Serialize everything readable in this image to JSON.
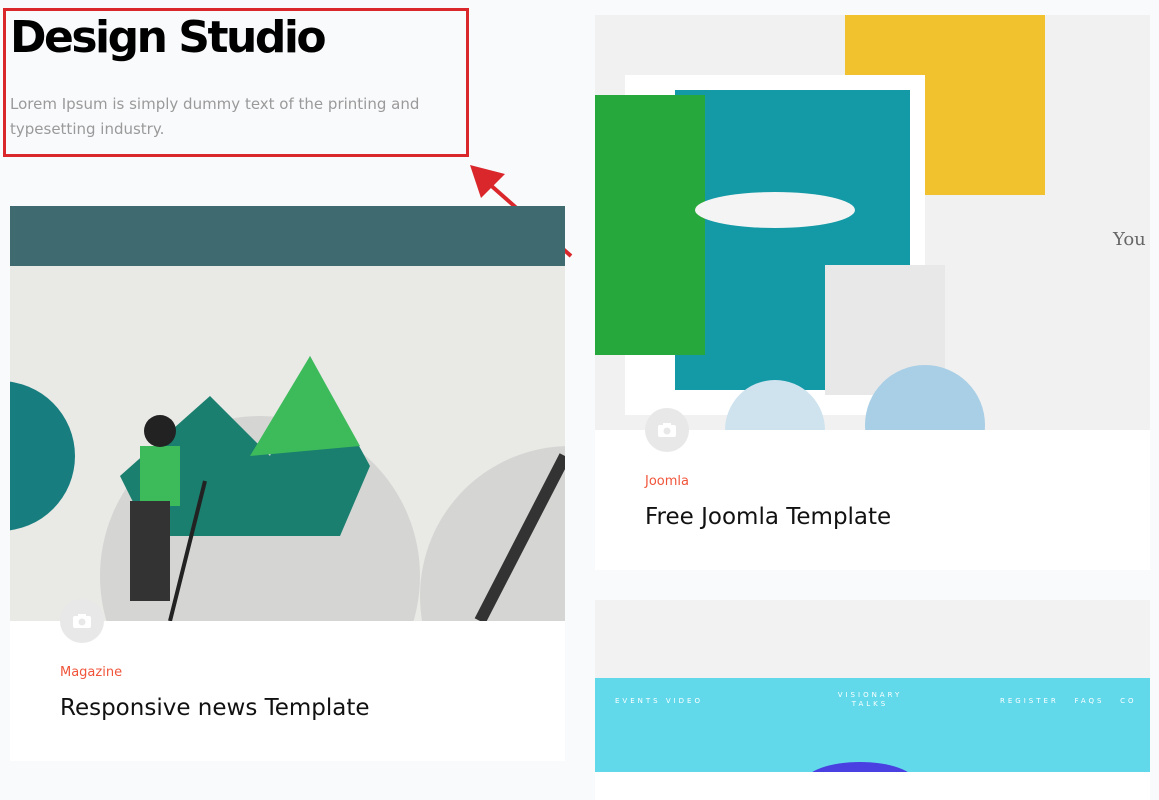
{
  "hero": {
    "title": "Design Studio",
    "subtitle": "Lorem Ipsum is simply dummy text of the printing and typesetting industry."
  },
  "cards": [
    {
      "category": "Magazine",
      "title": "Responsive news Template",
      "icon": "camera-icon"
    },
    {
      "category": "Joomla",
      "title": "Free Joomla Template",
      "icon": "camera-icon"
    },
    {
      "thumb_text": {
        "left": "EVENTS   VIDEO",
        "center": "VISIONARY TALKS",
        "right": "REGISTER   FAQS   CO"
      }
    }
  ],
  "colors": {
    "accent": "#f0553a",
    "highlight": "#d9272b"
  }
}
